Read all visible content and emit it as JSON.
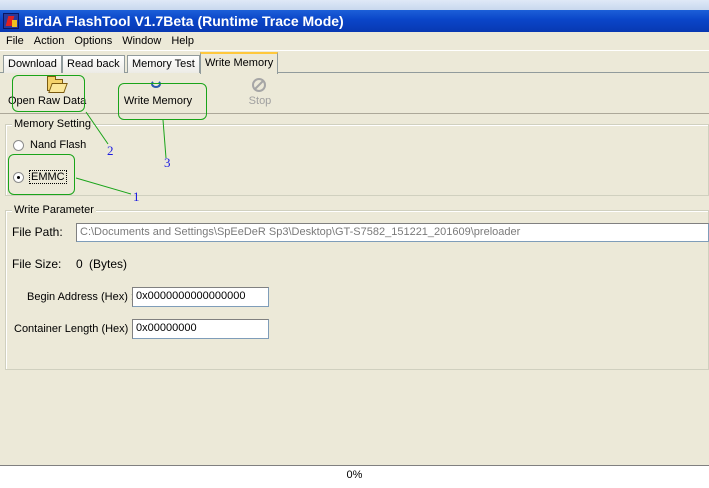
{
  "window": {
    "title": "BirdA FlashTool V1.7Beta (Runtime Trace Mode)"
  },
  "menu": [
    "File",
    "Action",
    "Options",
    "Window",
    "Help"
  ],
  "tabs": [
    {
      "label": "Download",
      "active": false
    },
    {
      "label": "Read back",
      "active": false
    },
    {
      "label": "Memory Test",
      "active": false
    },
    {
      "label": "Write Memory",
      "active": true
    }
  ],
  "toolbar": {
    "open_raw_data": "Open Raw Data",
    "write_memory": "Write Memory",
    "stop": "Stop"
  },
  "memory_setting": {
    "legend": "Memory Setting",
    "options": [
      {
        "label": "Nand Flash",
        "checked": false
      },
      {
        "label": "EMMC",
        "checked": true
      }
    ]
  },
  "write_parameter": {
    "legend": "Write Parameter",
    "file_path_label": "File Path:",
    "file_path_value": "C:\\Documents and Settings\\SpEeDeR Sp3\\Desktop\\GT-S7582_151221_201609\\preloader",
    "file_size_label": "File Size:",
    "file_size_value": "0",
    "file_size_unit": "(Bytes)",
    "begin_address_label": "Begin Address (Hex) :",
    "begin_address_value": "0x0000000000000000",
    "container_length_label": "Container Length (Hex) :",
    "container_length_value": "0x00000000"
  },
  "annotations": [
    "1",
    "2",
    "3"
  ],
  "status": {
    "progress_percent": 0,
    "progress_text": "0%"
  },
  "colors": {
    "titlebar": "#0a45c8",
    "annotation_box": "#1aa41a",
    "annotation_number": "#1a1ae0"
  }
}
